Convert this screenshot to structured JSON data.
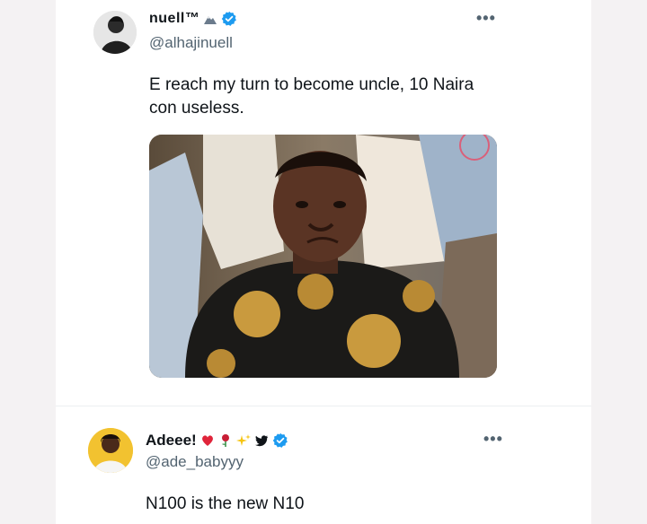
{
  "tweet1": {
    "display_name": "nuell™",
    "handle": "@alhajinuell",
    "text_line1": "E reach my turn to become uncle, 10 Naira",
    "text_line2": "con useless.",
    "more": "•••"
  },
  "tweet2": {
    "display_name": "Adeee!",
    "handle": "@ade_babyyy",
    "text": "N100 is the new N10",
    "more": "•••"
  },
  "colors": {
    "verified": "#1d9bf0",
    "handle": "#536471",
    "text": "#0f1419"
  },
  "icons": [
    "verified-badge-icon",
    "mountain-emoji-icon",
    "heart-emoji-icon",
    "rose-emoji-icon",
    "sparkles-emoji-icon",
    "bird-icon",
    "more-options-icon"
  ]
}
